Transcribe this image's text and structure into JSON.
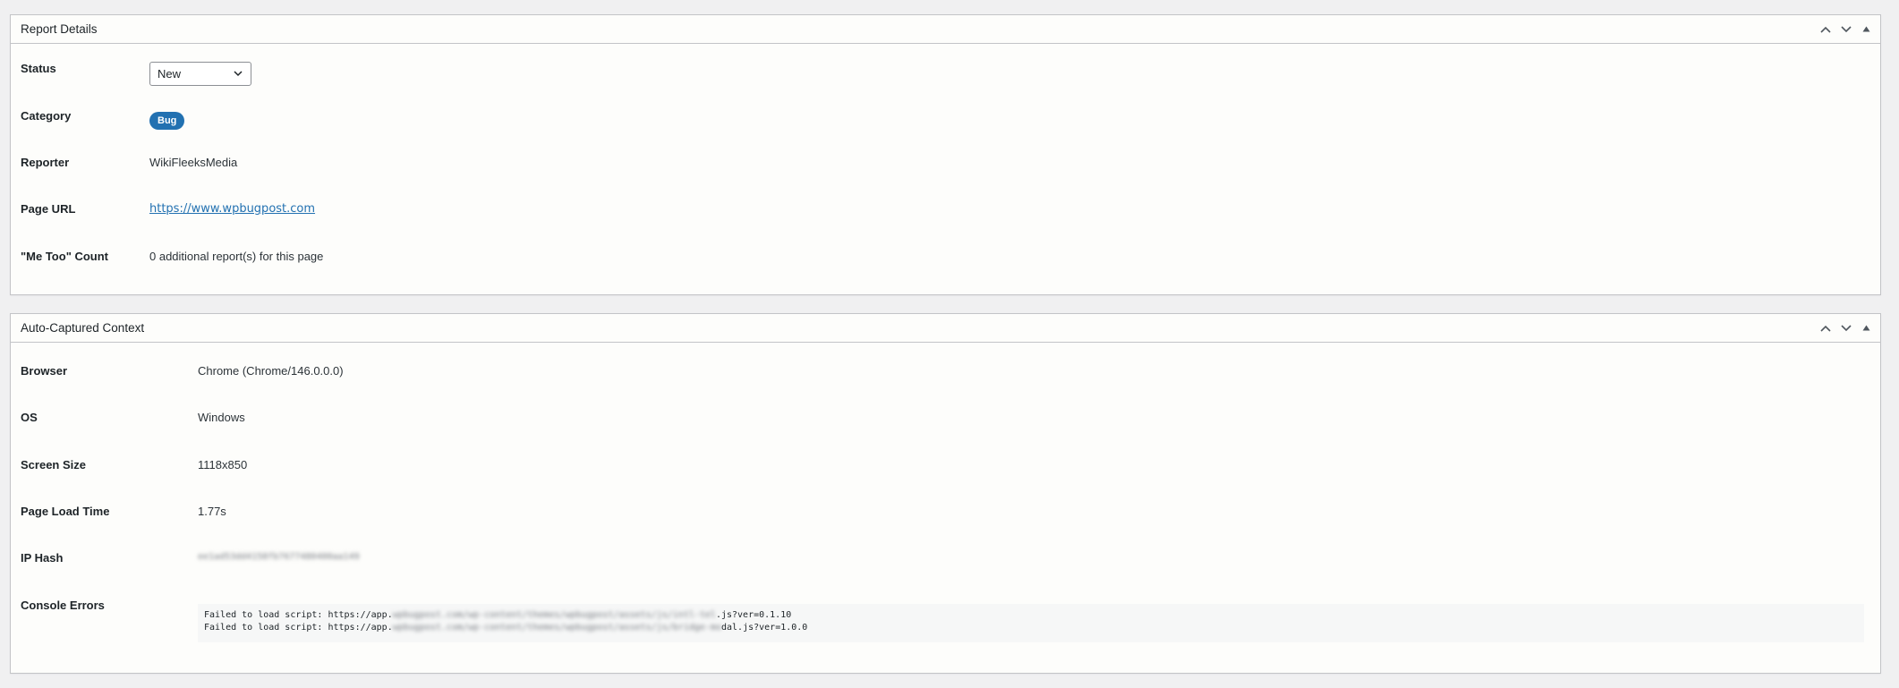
{
  "report": {
    "title": "Report Details",
    "status": {
      "label": "Status",
      "value": "New"
    },
    "category": {
      "label": "Category",
      "badge": "Bug"
    },
    "reporter": {
      "label": "Reporter",
      "value": "WikiFleeksMedia"
    },
    "page_url": {
      "label": "Page URL",
      "value": "https://www.wpbugpost.com"
    },
    "me_too": {
      "label": "\"Me Too\" Count",
      "value": "0 additional report(s) for this page"
    }
  },
  "context": {
    "title": "Auto-Captured Context",
    "browser": {
      "label": "Browser",
      "value": "Chrome (Chrome/146.0.0.0)"
    },
    "os": {
      "label": "OS",
      "value": "Windows"
    },
    "screen_size": {
      "label": "Screen Size",
      "value": "1118x850"
    },
    "load_time": {
      "label": "Page Load Time",
      "value": "1.77s"
    },
    "ip_hash": {
      "label": "IP Hash",
      "value": "ee1ad53dd4158fb7677480400aa149"
    },
    "console": {
      "label": "Console Errors",
      "line1": {
        "prefix": "Failed to load script: https://app.",
        "hidden": "wpbugpost.com/wp-content/themes/wpbugpost/assets/js/intl-tel",
        "suffix": ".js?ver=0.1.10"
      },
      "line2": {
        "prefix": "Failed to load script: https://app.",
        "hidden": "wpbugpost.com/wp-content/themes/wpbugpost/assets/js/bridge-mo",
        "suffix": "dal.js?ver=1.0.0"
      }
    }
  },
  "icons": {
    "move_up": "chevron-up-icon",
    "move_down": "chevron-down-icon",
    "toggle": "triangle-up-icon"
  },
  "colors": {
    "accent": "#2271b1",
    "panel_bg": "#fdfdfb",
    "page_bg": "#f0f0f1",
    "border": "#c3c4c7"
  }
}
